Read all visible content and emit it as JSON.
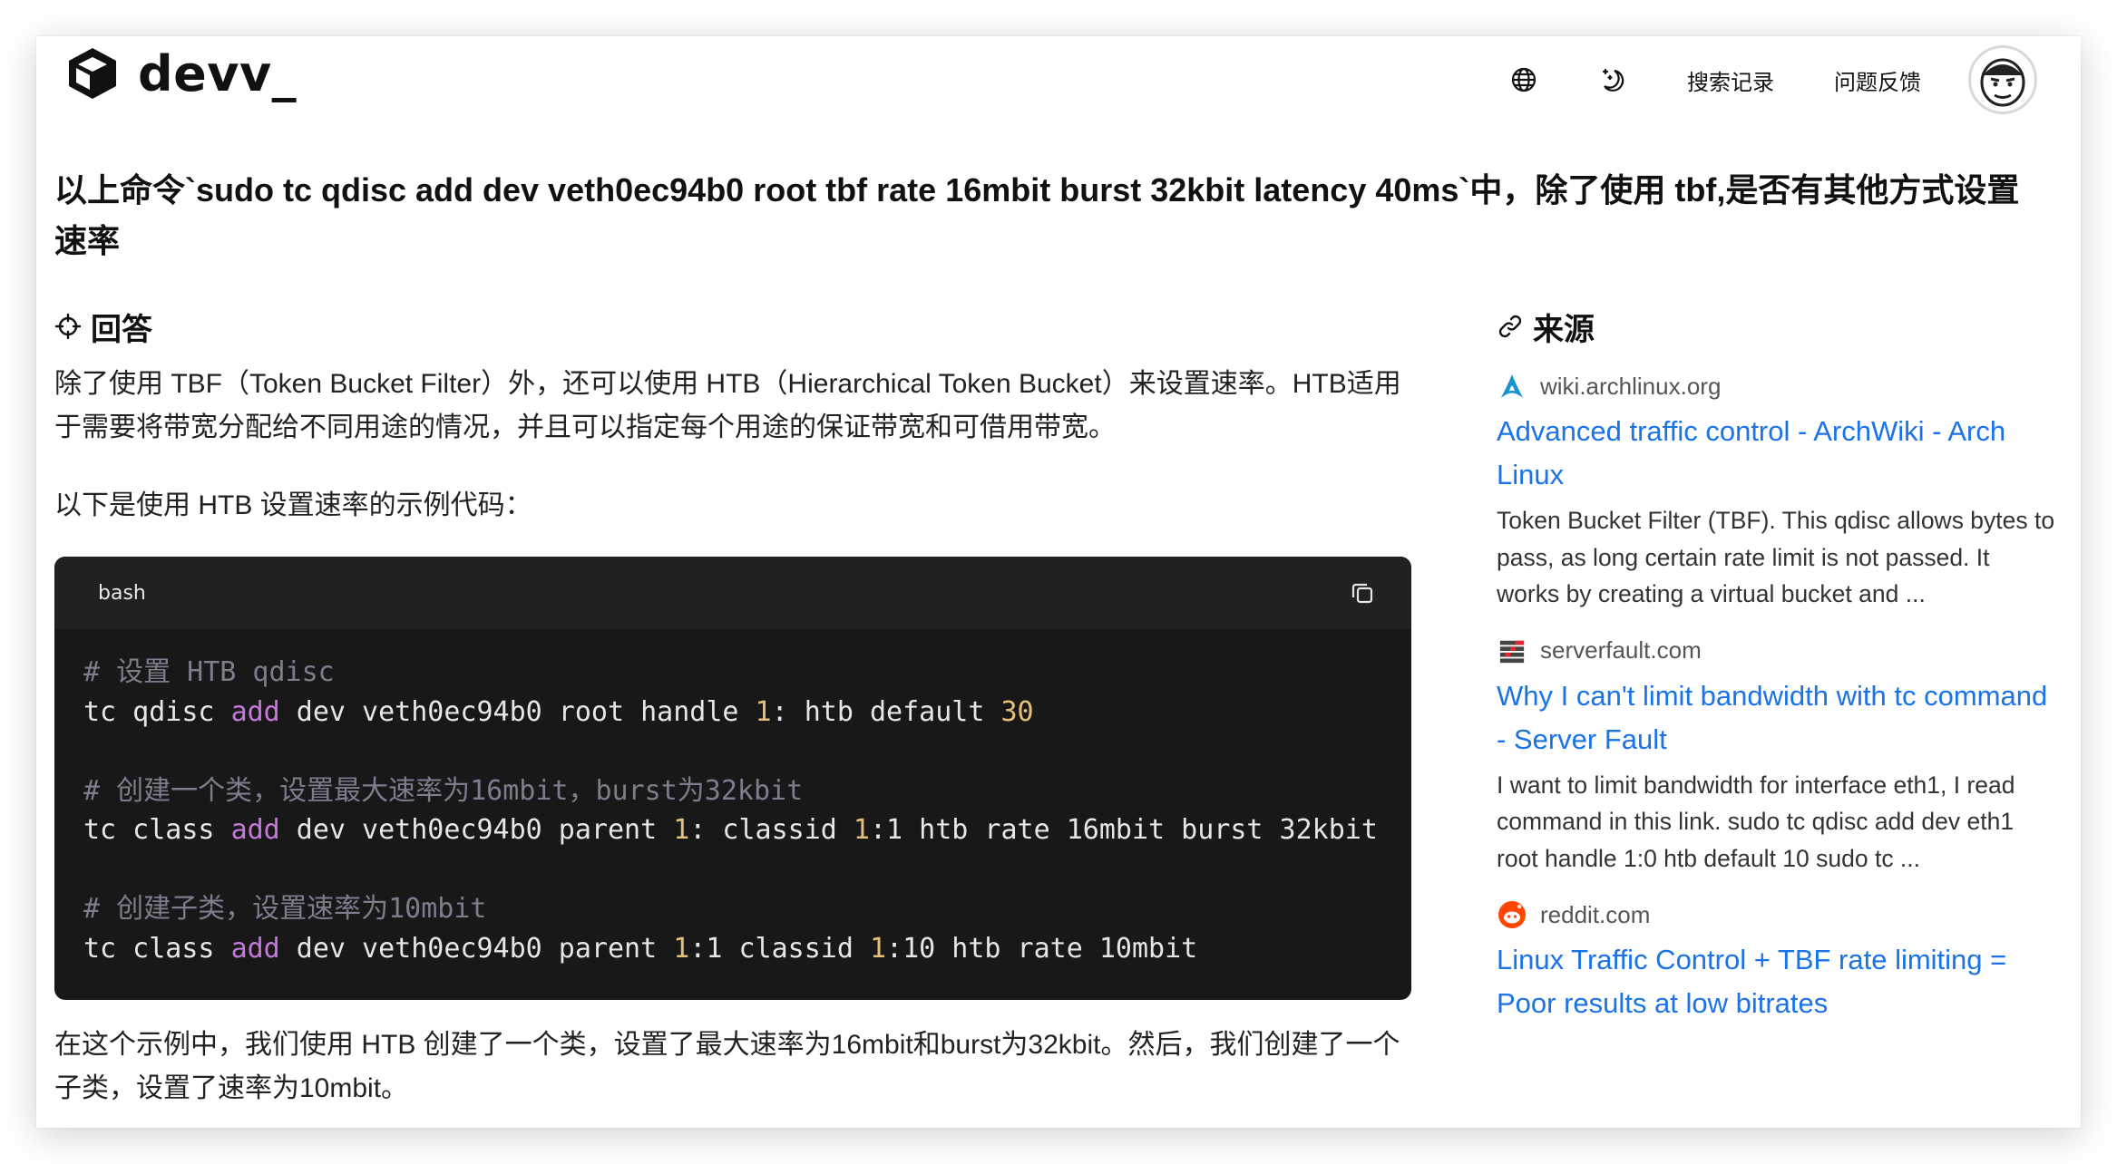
{
  "header": {
    "brand": "devv_",
    "icons": {
      "logo": "cube-logo-icon",
      "language": "globe-icon",
      "theme": "moon-stars-icon"
    },
    "history_label": "搜索记录",
    "feedback_label": "问题反馈",
    "avatar": "user-avatar"
  },
  "question": "以上命令`sudo tc qdisc add dev veth0ec94b0 root tbf rate 16mbit burst 32kbit latency 40ms`中，除了使用 tbf,是否有其他方式设置速率",
  "answer": {
    "title": "回答",
    "paragraphs": [
      "除了使用 TBF（Token Bucket Filter）外，还可以使用 HTB（Hierarchical Token Bucket）来设置速率。HTB适用于需要将带宽分配给不同用途的情况，并且可以指定每个用途的保证带宽和可借用带宽。",
      "以下是使用 HTB 设置速率的示例代码：",
      "在这个示例中，我们使用 HTB 创建了一个类，设置了最大速率为16mbit和burst为32kbit。然后，我们创建了一个子类，设置了速率为10mbit。"
    ],
    "code": {
      "language": "bash",
      "lines": [
        [
          {
            "t": "# 设置 HTB qdisc",
            "c": "comment"
          }
        ],
        [
          {
            "t": "tc qdisc "
          },
          {
            "t": "add",
            "c": "kw"
          },
          {
            "t": " dev veth0ec94b0 root handle "
          },
          {
            "t": "1",
            "c": "num"
          },
          {
            "t": ": htb default "
          },
          {
            "t": "30",
            "c": "num"
          }
        ],
        [],
        [
          {
            "t": "# 创建一个类，设置最大速率为16mbit，burst为32kbit",
            "c": "comment"
          }
        ],
        [
          {
            "t": "tc class "
          },
          {
            "t": "add",
            "c": "kw"
          },
          {
            "t": " dev veth0ec94b0 parent "
          },
          {
            "t": "1",
            "c": "num"
          },
          {
            "t": ": classid "
          },
          {
            "t": "1",
            "c": "num"
          },
          {
            "t": ":1 htb rate 16mbit burst 32kbit"
          }
        ],
        [],
        [
          {
            "t": "# 创建子类，设置速率为10mbit",
            "c": "comment"
          }
        ],
        [
          {
            "t": "tc class "
          },
          {
            "t": "add",
            "c": "kw"
          },
          {
            "t": " dev veth0ec94b0 parent "
          },
          {
            "t": "1",
            "c": "num"
          },
          {
            "t": ":1 classid "
          },
          {
            "t": "1",
            "c": "num"
          },
          {
            "t": ":10 htb rate 10mbit"
          }
        ]
      ]
    }
  },
  "sources": {
    "title": "来源",
    "items": [
      {
        "site": "wiki.archlinux.org",
        "favicon": "arch-linux-icon",
        "title": "Advanced traffic control - ArchWiki - Arch Linux",
        "snippet": "Token Bucket Filter (TBF). This qdisc allows bytes to pass, as long certain rate limit is not passed. It works by creating a virtual bucket and ..."
      },
      {
        "site": "serverfault.com",
        "favicon": "serverfault-icon",
        "title": "Why I can't limit bandwidth with tc command - Server Fault",
        "snippet": "I want to limit bandwidth for interface eth1, I read command in this link. sudo tc qdisc add dev eth1 root handle 1:0 htb default 10 sudo tc ..."
      },
      {
        "site": "reddit.com",
        "favicon": "reddit-icon",
        "title": "Linux Traffic Control + TBF rate limiting = Poor results at low bitrates",
        "snippet": ""
      }
    ]
  },
  "colors": {
    "link": "#1a73e8",
    "code_bg": "#181818",
    "code_header_bg": "#212121",
    "code_keyword": "#c678dd",
    "code_number": "#e5c07b",
    "code_comment": "#7d7d8e"
  }
}
